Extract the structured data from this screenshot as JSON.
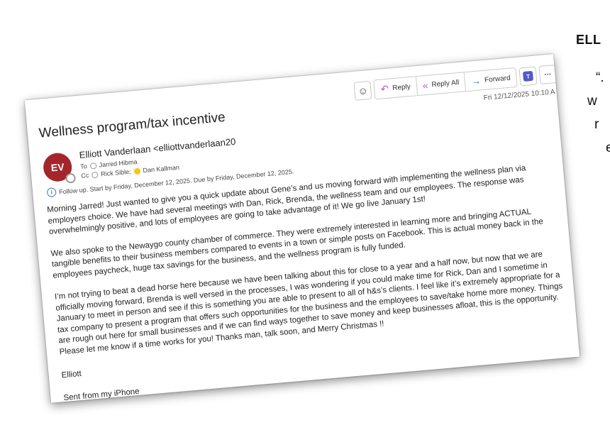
{
  "side_quote": {
    "heading": "ELL",
    "lines": [
      "“.",
      "w",
      "r",
      "e"
    ]
  },
  "email": {
    "subject": "Wellness program/tax incentive",
    "toolbar": {
      "emoji": "☺",
      "reply_label": "Reply",
      "reply_all_label": "Reply All",
      "forward_label": "Forward",
      "teams_icon": "teams",
      "more_label": "···"
    },
    "datetime": "Fri 12/12/2025 10:10 A",
    "avatar_initials": "EV",
    "sender": "Elliott Vanderlaan <elliottvanderlaan20",
    "to_label": "To",
    "to": "Jarred Hibma",
    "cc_label": "Cc",
    "cc": [
      "Rick Sible;",
      "Dan Kallman"
    ],
    "followup": "Follow up.  Start by Friday, December 12, 2025.  Due by Friday, December 12, 2025.",
    "body": [
      "Morning Jarred!  Just wanted to give you a quick update about Gene’s and us moving forward with implementing the wellness plan via employers choice.  We have had several meetings with Dan, Rick, Brenda, the wellness team and our employees.  The response was overwhelmingly positive, and lots of employees are going to take advantage of it!  We go live January 1st!",
      "We also spoke to the Newaygo county chamber of commerce.  They were extremely interested in learning more and bringing ACTUAL tangible benefits to their business members compared to events in a town or simple posts on Facebook.  This is actual money back in the employees paycheck, huge tax savings for the business, and the wellness program is fully funded.",
      "I’m not trying to beat a dead horse here because we have been talking about this for close to a year and a half now, but now that we are officially moving forward, Brenda is well versed in the processes, I was wondering if you could make time for Rick, Dan and I sometime in January to meet in person and see if this is something you are able to present to all of h&s’s clients.  I feel like it’s extremely appropriate for a tax company to present a program that offers such opportunities for the business and the employees to save/take home more money.  Things are rough out here for small businesses and if we can find ways together to save money and keep businesses afloat, this is the opportunity.  Please let me know if a time works for you!  Thanks man, talk soon, and Merry Christmas !!"
    ],
    "signature": "Elliott",
    "sent_from": "Sent from my iPhone"
  }
}
